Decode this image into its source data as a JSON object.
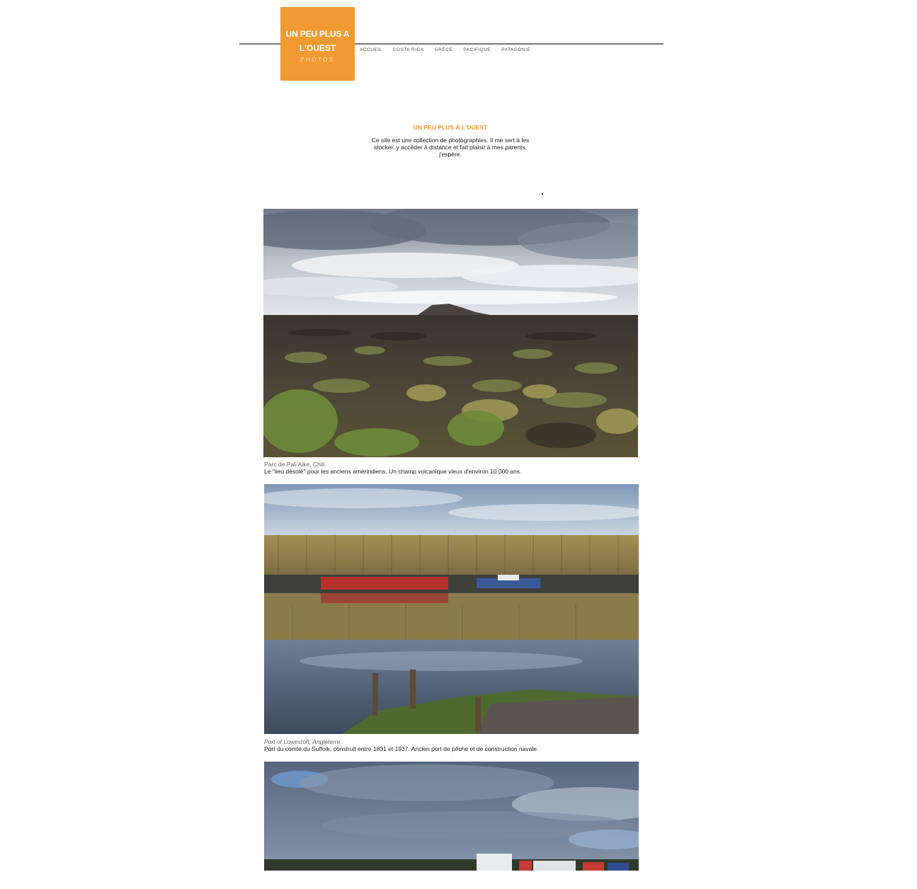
{
  "site": {
    "logo_line1": "UN PEU PLUS A",
    "logo_line2": "L'OUEST",
    "logo_line3": "PHOTOS",
    "brand_color": "#f29a32"
  },
  "nav": [
    "ACCUEIL",
    "COSTA RICA",
    "GRÈCE",
    "PACIFIQUE",
    "PATAGONIE"
  ],
  "intro": {
    "title": "UN PEU PLUS À L'OUEST",
    "text": "Ce site est une collection de photographies. Il me sert à les stocker, y accéder à distance et fait plaisir à mes parents, j'espère."
  },
  "photos": [
    {
      "image": "lava-field-volcano-photo",
      "place": "Parc de Pali Aike, Chili.",
      "description": "Le \"lieu désolé\" pour les anciens amérindiens. Un champ volcanique vieux d'environ 10 000 ans."
    },
    {
      "image": "harbour-reflection-photo",
      "place": "Port of Lowestoft, Angleterre.",
      "description": "Port du comté du Suffolk, construit entre 1831 et 1937. Ancien port de pêche et de construction navale."
    },
    {
      "image": "harbour-sky-photo"
    }
  ]
}
